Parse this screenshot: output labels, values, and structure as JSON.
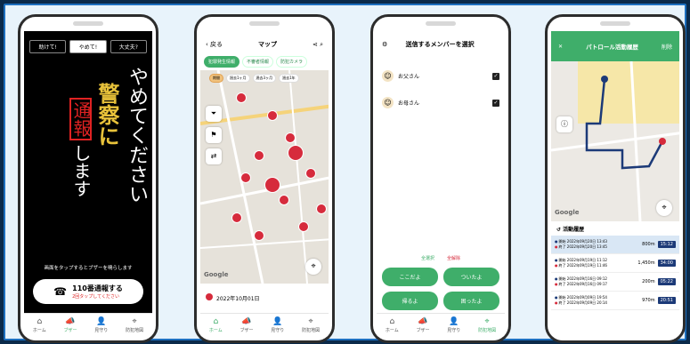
{
  "common": {
    "bottom_tabs": [
      {
        "label": "ホーム",
        "icon": "home-icon",
        "glyph": "⌂"
      },
      {
        "label": "ブザー",
        "icon": "buzzer-icon",
        "glyph": "📣"
      },
      {
        "label": "見守り",
        "icon": "watch-icon",
        "glyph": "👤"
      },
      {
        "label": "防犯地図",
        "icon": "map-pin-icon",
        "glyph": "⌖"
      }
    ],
    "accent": "#3fae6a",
    "danger": "#d62b3c"
  },
  "phone1": {
    "tabs": [
      "助けて!",
      "やめて!",
      "大丈夫?"
    ],
    "active_tab": "やめて!",
    "line1": "やめてください",
    "line2": "警察に",
    "line3_boxed": "通報",
    "line3_rest": "します",
    "hint": "画面をタップするとブザーを鳴らします",
    "call_title": "110番通報する",
    "call_sub": "2回タップしてください"
  },
  "phone2": {
    "back": "戻る",
    "title": "マップ",
    "chips": [
      "犯罪発生情報",
      "不審者情報",
      "防犯カメラ"
    ],
    "sub_chips": [
      "期間",
      "過去1ヶ月",
      "過去3ヶ月",
      "過去1年"
    ],
    "map_label": "Google",
    "date": "2022年10月01日"
  },
  "phone3": {
    "title": "送信するメンバーを選択",
    "members": [
      "お父さん",
      "お母さん"
    ],
    "select_all": "全選択",
    "deselect_all": "全解除",
    "buttons": [
      "ここだよ",
      "ついたよ",
      "帰るよ",
      "困ったよ"
    ]
  },
  "phone4": {
    "title": "パトロール活動履歴",
    "right": "削除",
    "map_label": "Google",
    "section": "活動履歴",
    "records": [
      {
        "start": "開始 2022年09月20日 13:43",
        "end": "終了 2022年09月20日 13:45",
        "distance": "800m",
        "duration": "15:12"
      },
      {
        "start": "開始 2022年09月19日 11:12",
        "end": "終了 2022年09月19日 11:46",
        "distance": "1,450m",
        "duration": "34:00"
      },
      {
        "start": "開始 2022年09月16日 09:12",
        "end": "終了 2022年09月16日 09:17",
        "distance": "200m",
        "duration": "05:22"
      },
      {
        "start": "開始 2022年09月09日 19:54",
        "end": "終了 2022年09月09日 20:14",
        "distance": "970m",
        "duration": "20:51"
      }
    ]
  }
}
